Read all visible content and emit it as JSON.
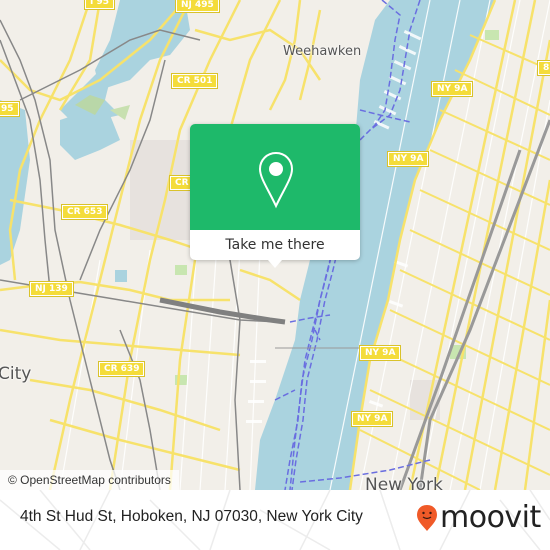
{
  "map": {
    "popup": {
      "button_label": "Take me there",
      "icon": "location-pin-icon",
      "color": "#1eb96a"
    },
    "attribution": "© OpenStreetMap contributors",
    "place_labels": [
      {
        "name": "Weehawken"
      },
      {
        "name": "City"
      },
      {
        "name": "New York"
      }
    ],
    "route_shields": [
      {
        "label": "I 95"
      },
      {
        "label": "NJ 495"
      },
      {
        "label": "CR 501"
      },
      {
        "label": "95"
      },
      {
        "label": "CR 653"
      },
      {
        "label": "CR"
      },
      {
        "label": "NY 9A"
      },
      {
        "label": "NY 9A"
      },
      {
        "label": "NY 9A"
      },
      {
        "label": "NY 9A"
      },
      {
        "label": "NJ 139"
      },
      {
        "label": "CR 639"
      },
      {
        "label": "8"
      }
    ],
    "colors": {
      "water": "#aad3df",
      "land": "#f2efe9",
      "road": "#f7e26b",
      "ferry": "#6a6ee0"
    }
  },
  "footer": {
    "address": "4th St Hud St, Hoboken, NJ 07030, New York City",
    "brand": "moovit",
    "brand_color": "#f05a28"
  }
}
